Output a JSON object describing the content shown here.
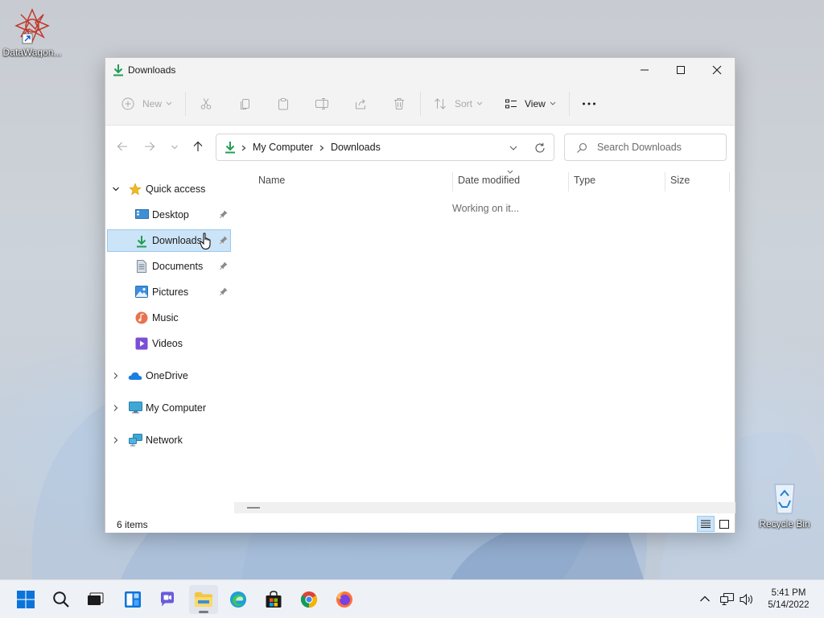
{
  "desktop": {
    "icons": [
      {
        "label": "DataWagon..."
      },
      {
        "label": "Recycle Bin"
      }
    ]
  },
  "window": {
    "title": "Downloads",
    "toolbar": {
      "new_label": "New",
      "sort_label": "Sort",
      "view_label": "View"
    },
    "address": {
      "crumbs": [
        "My Computer",
        "Downloads"
      ]
    },
    "search": {
      "placeholder": "Search Downloads"
    },
    "nav": {
      "quick_access": "Quick access",
      "items": [
        {
          "label": "Desktop",
          "icon": "desktop-folder-icon",
          "pinned": true
        },
        {
          "label": "Downloads",
          "icon": "download-arrow-icon",
          "pinned": true,
          "selected": true
        },
        {
          "label": "Documents",
          "icon": "documents-icon",
          "pinned": true
        },
        {
          "label": "Pictures",
          "icon": "pictures-icon",
          "pinned": true
        },
        {
          "label": "Music",
          "icon": "music-icon",
          "pinned": false
        },
        {
          "label": "Videos",
          "icon": "videos-icon",
          "pinned": false
        }
      ],
      "roots": [
        {
          "label": "OneDrive",
          "icon": "onedrive-icon"
        },
        {
          "label": "My Computer",
          "icon": "computer-icon"
        },
        {
          "label": "Network",
          "icon": "network-icon"
        }
      ]
    },
    "columns": [
      "Name",
      "Date modified",
      "Type",
      "Size"
    ],
    "status_message": "Working on it...",
    "status_bar": {
      "item_count": "6 items"
    }
  },
  "taskbar": {
    "apps": [
      "start",
      "search",
      "task-view",
      "widgets",
      "chat",
      "file-explorer",
      "edge",
      "store",
      "chrome",
      "firefox"
    ],
    "clock": {
      "time": "5:41 PM",
      "date": "5/14/2022"
    }
  },
  "colors": {
    "accent": "#0067c0",
    "selection_bg": "#cce4f7",
    "selection_border": "#99c9ef",
    "download_green": "#1f9d55"
  }
}
